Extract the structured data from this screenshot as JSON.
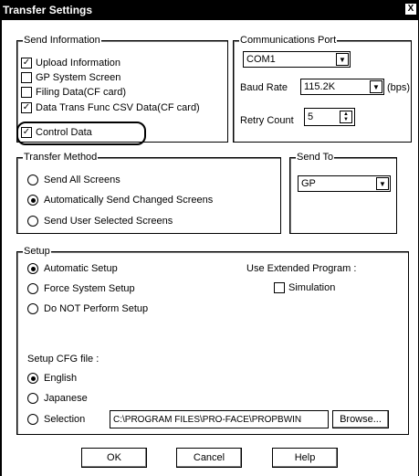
{
  "window": {
    "title": "Transfer Settings",
    "close_glyph": "X"
  },
  "send_info": {
    "legend": "Send Information",
    "items": [
      {
        "label": "Upload Information",
        "checked": true
      },
      {
        "label": "GP System Screen",
        "checked": false
      },
      {
        "label": "Filing Data(CF card)",
        "checked": false
      },
      {
        "label": "Data Trans Func CSV Data(CF card)",
        "checked": true
      },
      {
        "label": "Control Data",
        "checked": true
      }
    ]
  },
  "comm_port": {
    "legend": "Communications Port",
    "port_value": "COM1",
    "baud_label": "Baud Rate",
    "baud_value": "115.2K",
    "baud_unit": "(bps)",
    "retry_label": "Retry Count",
    "retry_value": "5"
  },
  "transfer_method": {
    "legend": "Transfer Method",
    "options": [
      {
        "label": "Send All Screens",
        "selected": false
      },
      {
        "label": "Automatically Send Changed Screens",
        "selected": true
      },
      {
        "label": "Send User Selected Screens",
        "selected": false
      }
    ]
  },
  "send_to": {
    "legend": "Send To",
    "value": "GP"
  },
  "setup": {
    "legend": "Setup",
    "options": [
      {
        "label": "Automatic Setup",
        "selected": true
      },
      {
        "label": "Force System Setup",
        "selected": false
      },
      {
        "label": "Do NOT Perform Setup",
        "selected": false
      }
    ],
    "extended_label": "Use Extended Program :",
    "simulation_label": "Simulation",
    "cfg_label": "Setup CFG file :",
    "cfg_options": [
      {
        "label": "English",
        "selected": true
      },
      {
        "label": "Japanese",
        "selected": false
      },
      {
        "label": "Selection",
        "selected": false
      }
    ],
    "path_value": "C:\\PROGRAM FILES\\PRO-FACE\\PROPBWIN",
    "browse_label": "Browse..."
  },
  "buttons": {
    "ok": "OK",
    "cancel": "Cancel",
    "help": "Help"
  }
}
